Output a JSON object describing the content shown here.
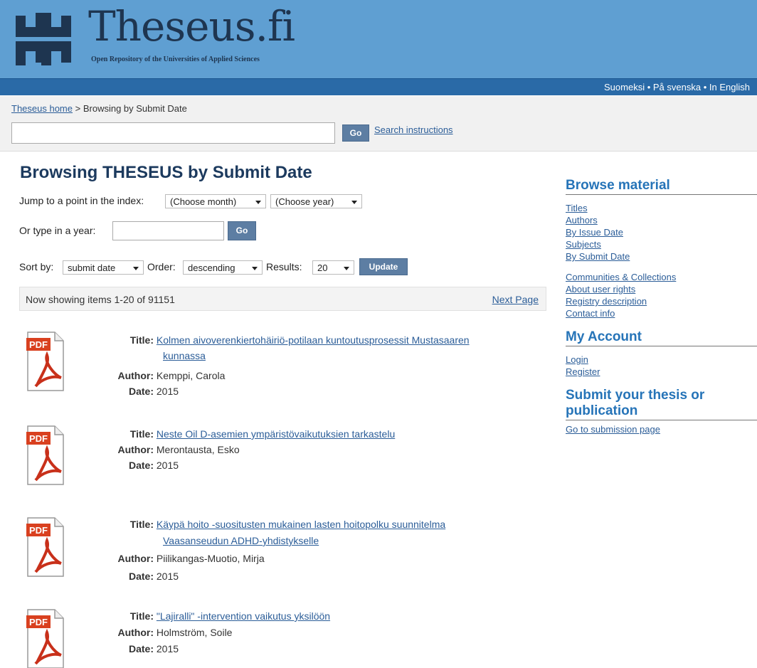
{
  "header": {
    "logo_title": "Theseus.fi",
    "logo_subtitle": "Open Repository of the Universities of Applied Sciences",
    "languages": [
      "Suomeksi",
      "På svenska",
      "In English"
    ],
    "language_separator": "•"
  },
  "breadcrumb": {
    "home": "Theseus home",
    "sep": ">",
    "current": "Browsing by Submit Date"
  },
  "top_search": {
    "value": "",
    "go_label": "Go",
    "instructions_label": "Search instructions"
  },
  "main": {
    "title": "Browsing THESEUS by Submit Date",
    "jump_label": "Jump to a point in the index:",
    "month_select": "(Choose month)",
    "year_select": "(Choose year)",
    "type_year_label": "Or type in a year:",
    "year_value": "",
    "go_label": "Go",
    "sort_by_label": "Sort by:",
    "sort_by_value": "submit date",
    "order_label": "Order:",
    "order_value": "descending",
    "results_label": "Results:",
    "results_value": "20",
    "update_label": "Update",
    "showing_text": "Now showing items 1-20 of 91151",
    "next_page": "Next Page"
  },
  "field_labels": {
    "title": "Title:",
    "author": "Author:",
    "date": "Date:"
  },
  "items": [
    {
      "title_line1": "Kolmen aivoverenkiertohäiriö-potilaan kuntoutusprosessit Mustasaaren",
      "title_line2": "kunnassa",
      "author": "Kemppi, Carola",
      "date": "2015"
    },
    {
      "title_line1": "Neste Oil D-asemien ympäristövaikutuksien tarkastelu",
      "title_line2": "",
      "author": "Merontausta, Esko",
      "date": "2015"
    },
    {
      "title_line1": "Käypä hoito -suositusten mukainen lasten hoitopolku suunnitelma",
      "title_line2": "Vaasanseudun ADHD-yhdistykselle",
      "author": "Piilikangas-Muotio, Mirja",
      "date": "2015"
    },
    {
      "title_line1": "\"Lajiralli\" -intervention vaikutus yksilöön",
      "title_line2": "",
      "author": "Holmström, Soile",
      "date": "2015"
    }
  ],
  "pdf_badge": "PDF",
  "sidebar": {
    "browse_heading": "Browse material",
    "browse_links": [
      "Titles",
      "Authors",
      "By Issue Date",
      "Subjects",
      "By Submit Date"
    ],
    "browse_links2": [
      "Communities & Collections",
      "About user rights",
      "Registry description",
      "Contact info"
    ],
    "account_heading": "My Account",
    "account_links": [
      "Login",
      "Register"
    ],
    "submit_heading": "Submit your thesis or publication",
    "submit_link": "Go to submission page"
  },
  "colors": {
    "header_bg": "#5f9fd2",
    "langbar_bg": "#2a6aa7",
    "heading_blue": "#2674b8",
    "link_blue": "#2b5d98",
    "button_bg": "#5d7ea3"
  }
}
